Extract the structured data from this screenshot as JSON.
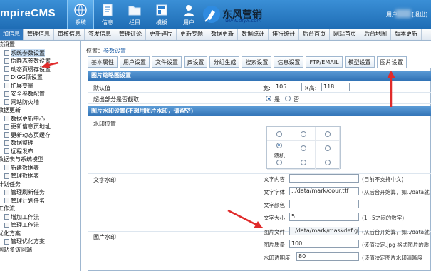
{
  "header": {
    "logo": "mpireCMS",
    "nav": [
      "系统",
      "信息",
      "栏目",
      "模板",
      "用户"
    ],
    "user_label": "用户",
    "logout": "[退出]",
    "watermark_title": "东风营销",
    "watermark_url": "www.dfyx.com"
  },
  "subnav": [
    "加信息",
    "管理信息",
    "审核信息",
    "签发信息",
    "管理评论",
    "更新碎片",
    "更新专题",
    "数据更新",
    "数据统计",
    "排行统计",
    "后台首页",
    "网站首页",
    "后台地图",
    "版本更新"
  ],
  "tree": [
    {
      "label": "统设置",
      "level": 0
    },
    {
      "label": "系统参数设置",
      "level": 1,
      "selected": true
    },
    {
      "label": "伪静态参数设置",
      "level": 1
    },
    {
      "label": "动态页缓存设置",
      "level": 1
    },
    {
      "label": "DIGG顶设置",
      "level": 1
    },
    {
      "label": "扩展变量",
      "level": 1
    },
    {
      "label": "安全参数配置",
      "level": 1
    },
    {
      "label": "网站防火墙",
      "level": 1
    },
    {
      "label": "数据更新",
      "level": 0
    },
    {
      "label": "数据更新中心",
      "level": 1
    },
    {
      "label": "更新信息页地址",
      "level": 1
    },
    {
      "label": "更新动态页缓存",
      "level": 1
    },
    {
      "label": "数据整理",
      "level": 1
    },
    {
      "label": "远程发布",
      "level": 1
    },
    {
      "label": "数据表与系统模型",
      "level": 0
    },
    {
      "label": "新建数据表",
      "level": 1
    },
    {
      "label": "管理数据表",
      "level": 1
    },
    {
      "label": "计划任务",
      "level": 0
    },
    {
      "label": "管理刷新任务",
      "level": 1
    },
    {
      "label": "管理计划任务",
      "level": 1
    },
    {
      "label": "工作流",
      "level": 0
    },
    {
      "label": "增加工作流",
      "level": 1
    },
    {
      "label": "管理工作流",
      "level": 1
    },
    {
      "label": "优化方案",
      "level": 0
    },
    {
      "label": "管理优化方案",
      "level": 1
    },
    {
      "label": "网站多访问端",
      "level": 0
    }
  ],
  "content": {
    "crumb_prefix": "位置：",
    "crumb_link": "参数设置",
    "tabs": [
      "基本属性",
      "用户设置",
      "文件设置",
      "JS设置",
      "分组生成",
      "搜索设置",
      "信息设置",
      "FTP/EMAIL",
      "模型设置",
      "图片设置"
    ],
    "thumb": {
      "section": "图片缩略图设置",
      "default_label": "默认值",
      "width_label": "宽:",
      "width": "105",
      "height_label": "×高:",
      "height": "118",
      "crop_label": "超出部分是否截取",
      "yes": "是",
      "no": "否"
    },
    "watermark": {
      "section": "图片水印设置(不想用图片水印，请留空)",
      "position_label": "水印位置",
      "random_label": "随机",
      "text_wm_label": "文字水印",
      "text_content_label": "文字内容",
      "text_content_hint": "(目前不支持中文)",
      "font_label": "文字字体",
      "font_value": "../data/mark/cour.ttf",
      "font_hint": "(从后台开始算，如../data就",
      "color_label": "文字颜色",
      "size_label": "文字大小",
      "size_value": "5",
      "size_hint": "(1~5之间的数字)",
      "image_wm_label": "图片水印",
      "file_label": "图片文件",
      "file_value": "../data/mark/maskdef.gif",
      "file_hint": "(从后台开始算，如../data就",
      "quality_label": "图片质量",
      "quality_value": "100",
      "quality_hint": "(该值决定.jpg 格式图片的质",
      "opacity_label": "水印透明度",
      "opacity_value": "80",
      "opacity_hint": "(该值决定图片水印清晰度"
    }
  },
  "colors": {
    "accent": "#2f78c0",
    "arrow": "#e02b2b",
    "header": "#1f6db5"
  }
}
